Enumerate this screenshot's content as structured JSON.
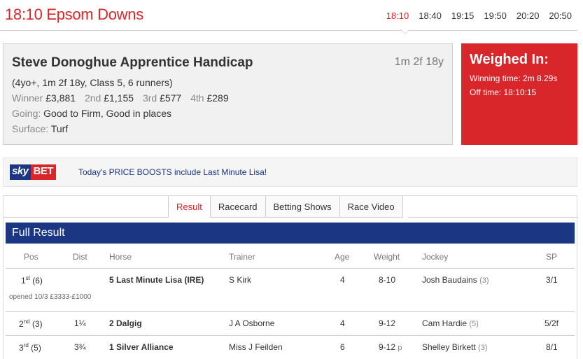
{
  "header": {
    "venue_title": "18:10 Epsom Downs",
    "times": [
      {
        "label": "18:10",
        "active": true
      },
      {
        "label": "18:40",
        "active": false
      },
      {
        "label": "19:15",
        "active": false
      },
      {
        "label": "19:50",
        "active": false
      },
      {
        "label": "20:20",
        "active": false
      },
      {
        "label": "20:50",
        "active": false
      }
    ]
  },
  "race": {
    "name": "Steve Donoghue Apprentice Handicap",
    "distance": "1m 2f 18y",
    "conditions": "(4yo+, 1m 2f 18y, Class 5, 6 runners)",
    "prizes": [
      {
        "label": "Winner",
        "value": "£3,881"
      },
      {
        "label": "2nd",
        "value": "£1,155"
      },
      {
        "label": "3rd",
        "value": "£577"
      },
      {
        "label": "4th",
        "value": "£289"
      }
    ],
    "going_label": "Going:",
    "going_value": "Good to Firm, Good in places",
    "surface_label": "Surface:",
    "surface_value": "Turf"
  },
  "weighed_in": {
    "title": "Weighed In:",
    "winning_time": "Winning time: 2m 8.29s",
    "off_time": "Off time: 18:10:15"
  },
  "promo": {
    "logo_sky": "sky",
    "logo_bet": "BET",
    "text": "Today's PRICE BOOSTS include Last Minute Lisa!"
  },
  "tabs": [
    "Result",
    "Racecard",
    "Betting Shows",
    "Race Video"
  ],
  "results": {
    "title": "Full Result",
    "columns": {
      "pos": "Pos",
      "dist": "Dist",
      "horse": "Horse",
      "trainer": "Trainer",
      "age": "Age",
      "weight": "Weight",
      "jockey": "Jockey",
      "sp": "SP"
    },
    "rows": [
      {
        "pos": "1",
        "pos_sup": "st",
        "draw": "(6)",
        "dist": "",
        "horse": "5 Last Minute Lisa (IRE)",
        "trainer": "S Kirk",
        "age": "4",
        "weight": "8-10",
        "weight_note": "",
        "jockey": "Josh Baudains",
        "claim": "(3)",
        "sp": "3/1",
        "opened": "opened 10/3 £3333-£1000"
      },
      {
        "pos": "2",
        "pos_sup": "nd",
        "draw": "(3)",
        "dist": "1¼",
        "horse": "2 Dalgig",
        "trainer": "J A Osborne",
        "age": "4",
        "weight": "9-12",
        "weight_note": "",
        "jockey": "Cam Hardie",
        "claim": "(5)",
        "sp": "5/2f",
        "opened": ""
      },
      {
        "pos": "3",
        "pos_sup": "rd",
        "draw": "(5)",
        "dist": "3¾",
        "horse": "1 Silver Alliance",
        "trainer": "Miss J Feilden",
        "age": "6",
        "weight": "9-12",
        "weight_note": "p",
        "jockey": "Shelley Birkett",
        "claim": "(3)",
        "sp": "8/1",
        "opened": ""
      }
    ]
  }
}
